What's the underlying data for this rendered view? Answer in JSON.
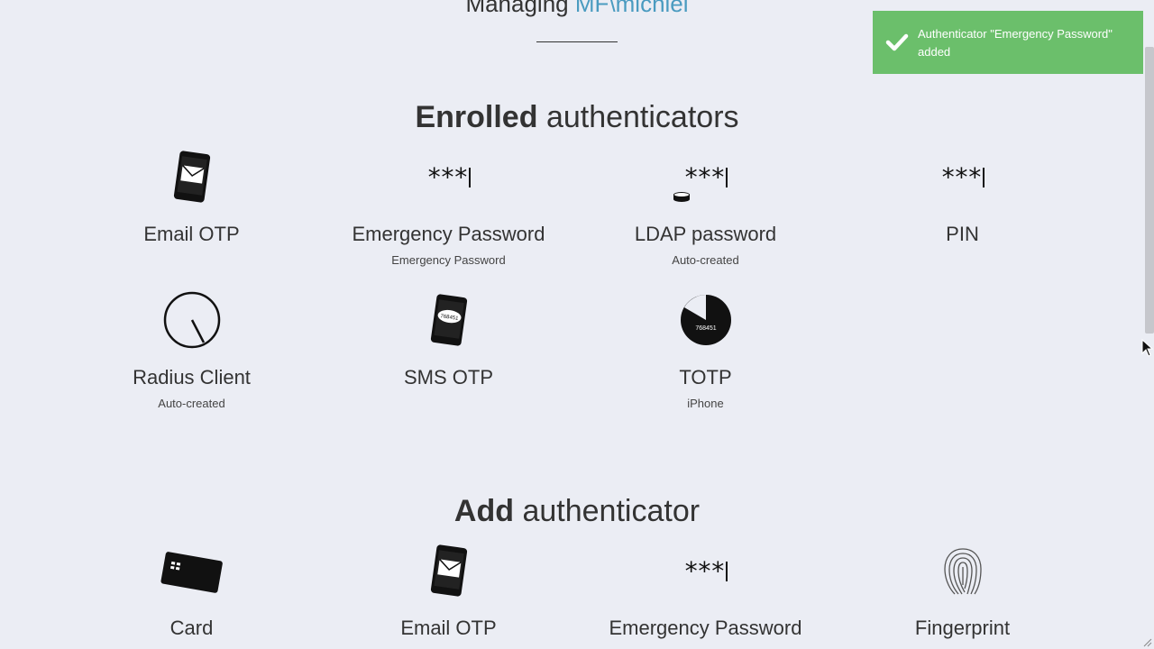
{
  "header": {
    "managing_label": "Managing",
    "user": "MF\\michiel"
  },
  "enrolled": {
    "title_bold": "Enrolled",
    "title_rest": "authenticators",
    "items": [
      {
        "name": "Email OTP",
        "sub": "",
        "icon": "email-phone-icon"
      },
      {
        "name": "Emergency Password",
        "sub": "Emergency Password",
        "icon": "password-stars-icon",
        "icon_text": "***"
      },
      {
        "name": "LDAP password",
        "sub": "Auto-created",
        "icon": "ldap-password-icon",
        "icon_text": "***"
      },
      {
        "name": "PIN",
        "sub": "",
        "icon": "pin-stars-icon",
        "icon_text": "***"
      },
      {
        "name": "Radius Client",
        "sub": "Auto-created",
        "icon": "radius-clock-icon"
      },
      {
        "name": "SMS OTP",
        "sub": "",
        "icon": "sms-phone-icon",
        "icon_text": "768451"
      },
      {
        "name": "TOTP",
        "sub": "iPhone",
        "icon": "totp-timer-icon",
        "icon_text": "768451"
      }
    ]
  },
  "add": {
    "title_bold": "Add",
    "title_rest": "authenticator",
    "items": [
      {
        "name": "Card",
        "icon": "card-icon"
      },
      {
        "name": "Email OTP",
        "icon": "email-phone-icon"
      },
      {
        "name": "Emergency Password",
        "icon": "password-stars-icon",
        "icon_text": "***"
      },
      {
        "name": "Fingerprint",
        "icon": "fingerprint-icon"
      }
    ]
  },
  "toast": {
    "message": "Authenticator \"Emergency Password\" added",
    "status_color": "#6bbf6b"
  },
  "colors": {
    "background": "#ebedf4",
    "accent": "#4a9bc0",
    "text": "#333333"
  }
}
